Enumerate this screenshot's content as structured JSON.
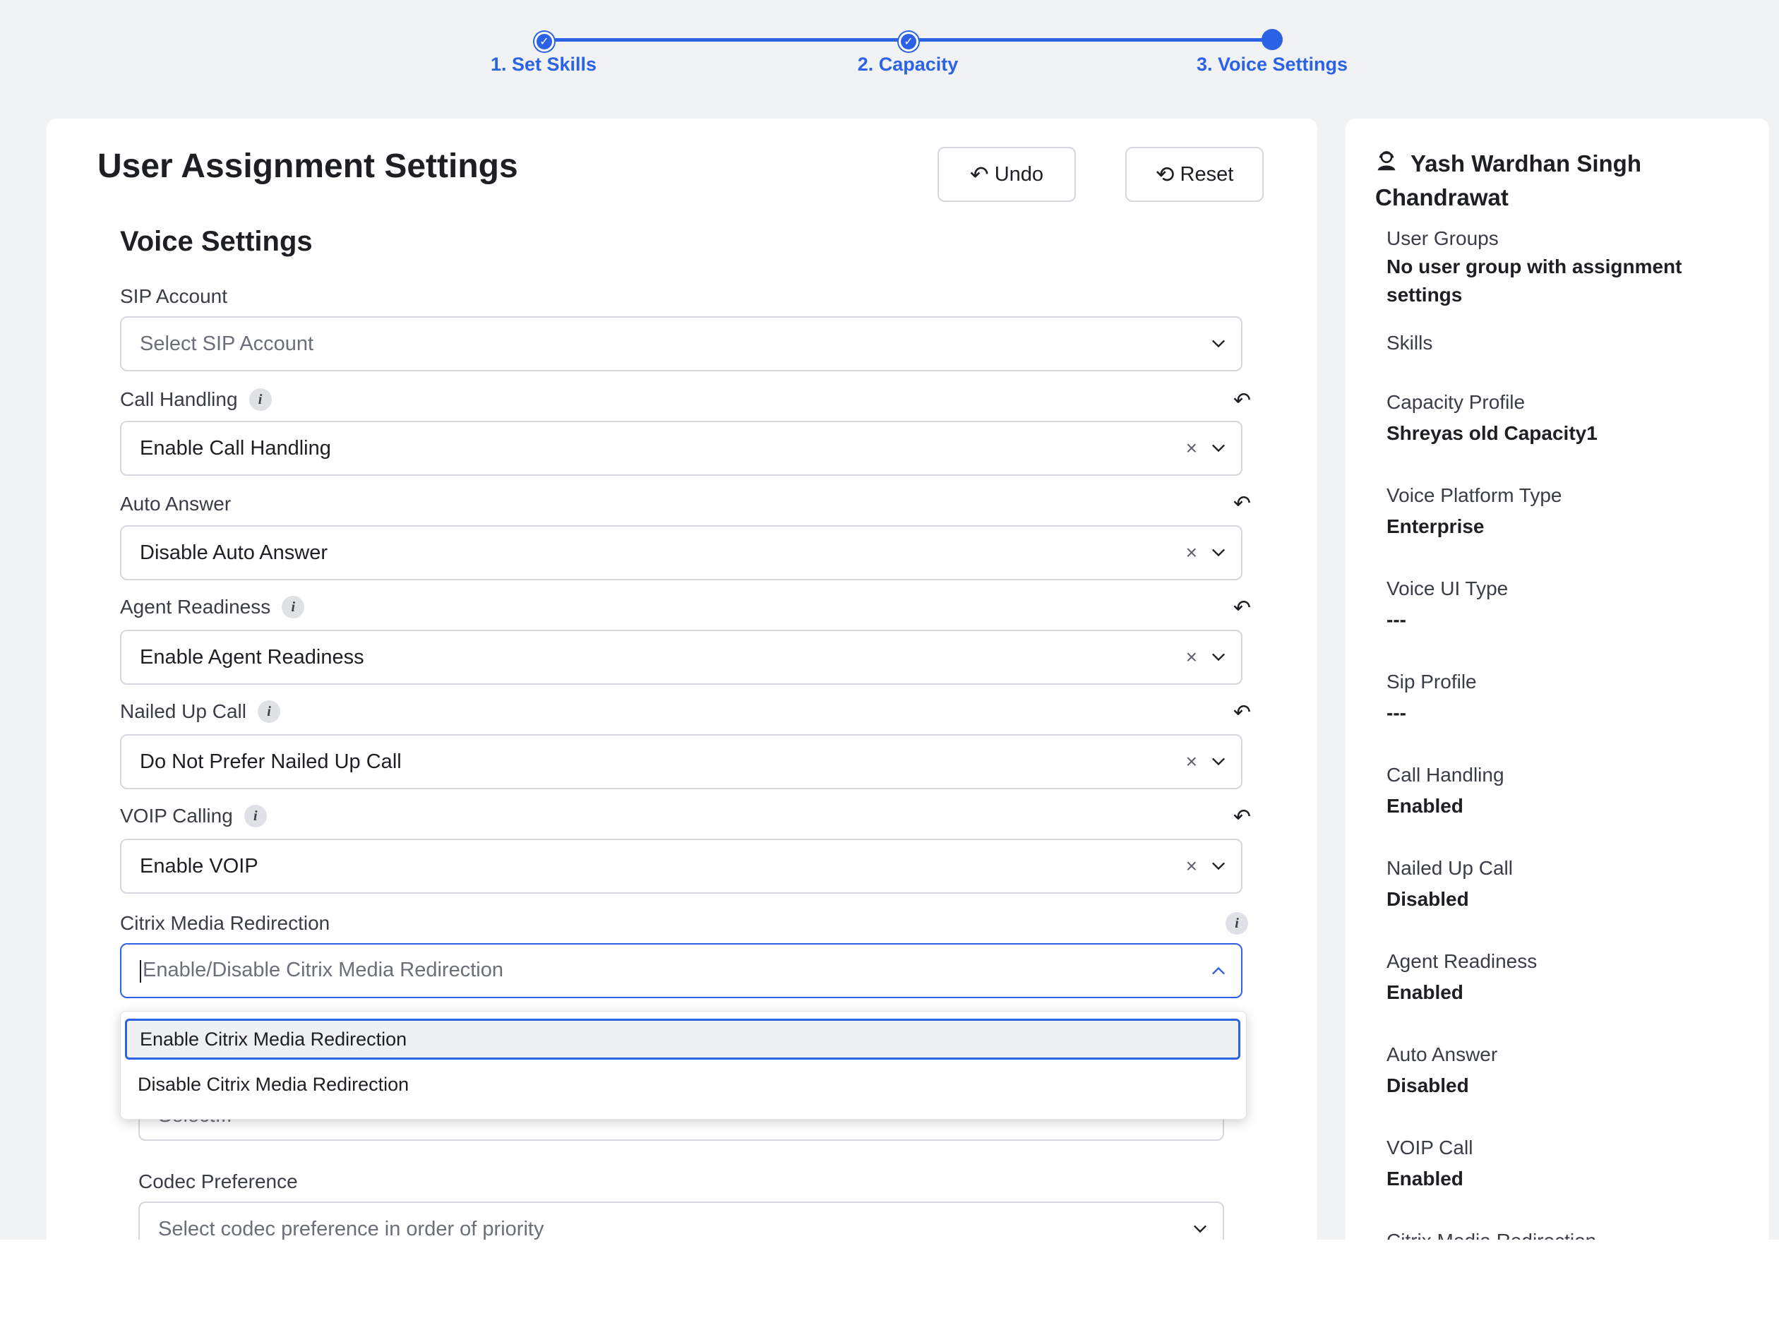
{
  "stepper": {
    "steps": [
      {
        "label": "1. Set Skills",
        "state": "done"
      },
      {
        "label": "2. Capacity",
        "state": "done"
      },
      {
        "label": "3. Voice Settings",
        "state": "current"
      }
    ],
    "accent": "#2c62e6"
  },
  "main": {
    "title": "User Assignment Settings",
    "undo_label": "Undo",
    "reset_label": "Reset",
    "section_title": "Voice Settings",
    "fields": {
      "sip": {
        "label": "SIP Account",
        "placeholder": "Select SIP Account"
      },
      "call_handling": {
        "label": "Call Handling",
        "value": "Enable Call Handling"
      },
      "auto_answer": {
        "label": "Auto Answer",
        "value": "Disable Auto Answer"
      },
      "agent_readiness": {
        "label": "Agent Readiness",
        "value": "Enable Agent Readiness"
      },
      "nailed_up": {
        "label": "Nailed Up Call",
        "value": "Do Not Prefer Nailed Up Call"
      },
      "voip": {
        "label": "VOIP Calling",
        "value": "Enable VOIP"
      },
      "citrix": {
        "label": "Citrix Media Redirection",
        "placeholder": "Enable/Disable Citrix Media Redirection"
      },
      "hidden_select": {
        "placeholder": "Select..."
      },
      "codec": {
        "label": "Codec Preference",
        "placeholder": "Select codec preference in order of priority"
      }
    },
    "citrix_options": [
      "Enable Citrix Media Redirection",
      "Disable Citrix Media Redirection"
    ]
  },
  "summary": {
    "user_name": "Yash Wardhan Singh Chandrawat",
    "items": [
      {
        "key": "User Groups",
        "value": "No user group with assignment settings"
      },
      {
        "key": "Skills",
        "value": ""
      },
      {
        "key": "Capacity Profile",
        "value": "Shreyas old Capacity1"
      },
      {
        "key": "Voice Platform Type",
        "value": "Enterprise"
      },
      {
        "key": "Voice UI Type",
        "value": "---"
      },
      {
        "key": "Sip Profile",
        "value": "---"
      },
      {
        "key": "Call Handling",
        "value": "Enabled"
      },
      {
        "key": "Nailed Up Call",
        "value": "Disabled"
      },
      {
        "key": "Agent Readiness",
        "value": "Enabled"
      },
      {
        "key": "Auto Answer",
        "value": "Disabled"
      },
      {
        "key": "VOIP Call",
        "value": "Enabled"
      },
      {
        "key": "Citrix Media Redirection",
        "value": ""
      }
    ]
  }
}
